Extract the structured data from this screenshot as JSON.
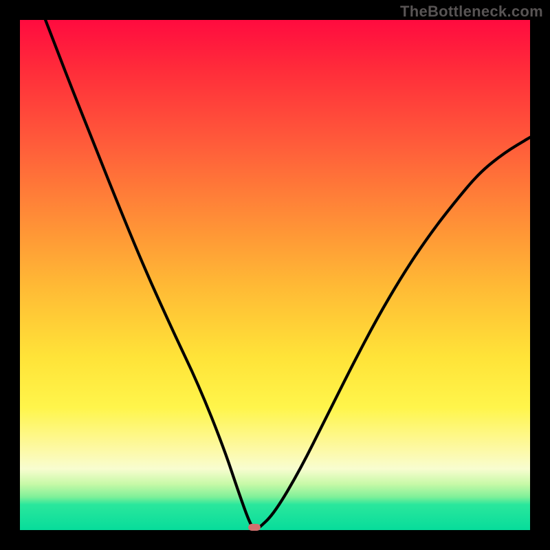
{
  "watermark": "TheBottleneck.com",
  "colors": {
    "frame": "#000000",
    "gradient_top": "#ff0b3f",
    "gradient_mid1": "#ff8a37",
    "gradient_mid2": "#ffe338",
    "gradient_bottom": "#07dc9b",
    "curve": "#000000",
    "marker": "#d0716e"
  },
  "chart_data": {
    "type": "line",
    "title": "",
    "xlabel": "",
    "ylabel": "",
    "xlim": [
      0,
      100
    ],
    "ylim": [
      0,
      100
    ],
    "grid": false,
    "legend": false,
    "series": [
      {
        "name": "bottleneck-curve",
        "x": [
          5,
          10,
          15,
          20,
          25,
          30,
          35,
          40,
          43,
          45,
          46,
          47,
          50,
          55,
          60,
          65,
          70,
          75,
          80,
          85,
          90,
          95,
          100
        ],
        "values": [
          100,
          87,
          74.5,
          62,
          50,
          39,
          28.5,
          16,
          7,
          1.5,
          0,
          0.5,
          3.5,
          12,
          22,
          32,
          41.5,
          50,
          57.5,
          64,
          70,
          74,
          77
        ]
      }
    ],
    "markers": [
      {
        "name": "minimum-marker",
        "x": 46,
        "y": 0.5
      }
    ]
  }
}
